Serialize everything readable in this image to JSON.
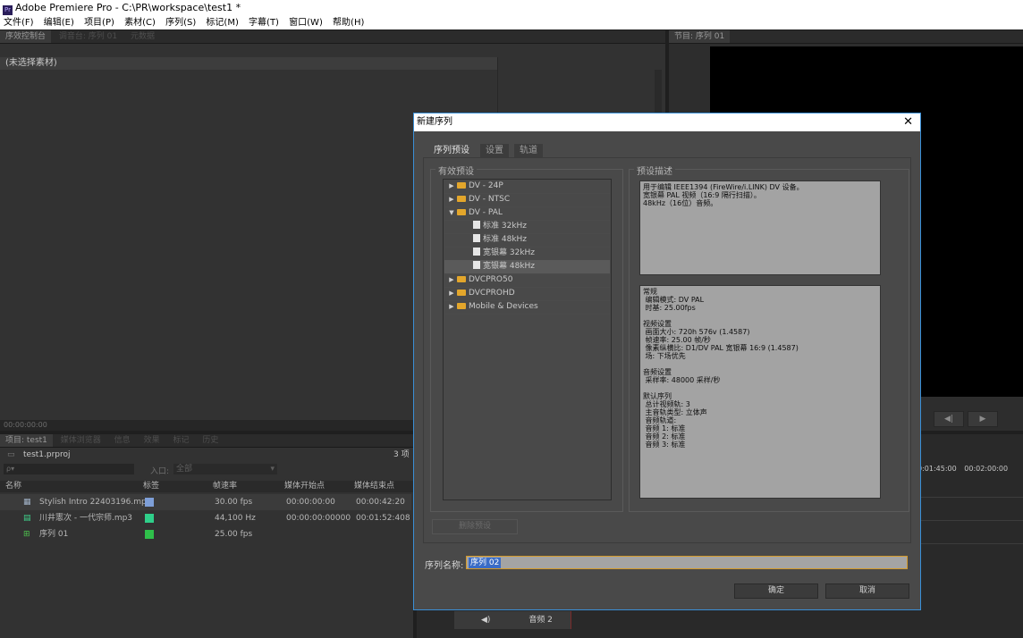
{
  "app": {
    "title": "Adobe Premiere Pro - C:\\PR\\workspace\\test1 *",
    "logo": "Pr"
  },
  "menu": [
    "文件(F)",
    "编辑(E)",
    "项目(P)",
    "素材(C)",
    "序列(S)",
    "标记(M)",
    "字幕(T)",
    "窗口(W)",
    "帮助(H)"
  ],
  "source_panel": {
    "tabs": [
      "序效控制台",
      "调音台: 序列 01",
      "元数据"
    ],
    "no_clip": "(未选择素材)",
    "timecode": "00:00:00:00"
  },
  "program_panel": {
    "tab": "节目: 序列 01",
    "timecodes": [
      "0:01:45:00",
      "00:02:00:00"
    ]
  },
  "project_panel": {
    "tabs": [
      "项目: test1",
      "媒体浏览器",
      "信息",
      "效果",
      "标记",
      "历史"
    ],
    "project_file": "test1.prproj",
    "item_count": "3 项",
    "search_placeholder": "ρ▾",
    "in_label": "入口:",
    "in_value": "全部",
    "columns": [
      "名称",
      "标签",
      "帧速率",
      "媒体开始点",
      "媒体结束点"
    ],
    "rows": [
      {
        "name": "Stylish Intro 22403196.mp4",
        "label_color": "#7e9fd8",
        "fps": "30.00 fps",
        "start": "00:00:00:00",
        "end": "00:00:42:20"
      },
      {
        "name": "川井憲次 - 一代宗师.mp3",
        "label_color": "#2fcf8a",
        "fps": "44,100 Hz",
        "start": "00:00:00:00000",
        "end": "00:01:52:408"
      },
      {
        "name": "序列 01",
        "label_color": "#2fbf4a",
        "fps": "25.00 fps",
        "start": "",
        "end": ""
      }
    ]
  },
  "timeline": {
    "track_label": "音频 2"
  },
  "dialog": {
    "title": "新建序列",
    "tabs": [
      "序列预设",
      "设置",
      "轨道"
    ],
    "presets_label": "有效预设",
    "desc_label": "预设描述",
    "tree": [
      {
        "label": "DV - 24P",
        "type": "folder",
        "level": 0,
        "expanded": false
      },
      {
        "label": "DV - NTSC",
        "type": "folder",
        "level": 0,
        "expanded": false
      },
      {
        "label": "DV - PAL",
        "type": "folder",
        "level": 0,
        "expanded": true
      },
      {
        "label": "标准 32kHz",
        "type": "preset",
        "level": 1
      },
      {
        "label": "标准 48kHz",
        "type": "preset",
        "level": 1
      },
      {
        "label": "宽银幕 32kHz",
        "type": "preset",
        "level": 1
      },
      {
        "label": "宽银幕 48kHz",
        "type": "preset",
        "level": 1,
        "selected": true
      },
      {
        "label": "DVCPRO50",
        "type": "folder",
        "level": 0,
        "expanded": false
      },
      {
        "label": "DVCPROHD",
        "type": "folder",
        "level": 0,
        "expanded": false
      },
      {
        "label": "Mobile & Devices",
        "type": "folder",
        "level": 0,
        "expanded": false
      }
    ],
    "description": [
      "用于编辑 IEEE1394 (FireWire/i.LINK) DV 设备。",
      "宽银幕 PAL 视频（16:9 隔行扫描）。",
      "48kHz（16位）音频。"
    ],
    "details": [
      "常规",
      " 编辑模式: DV PAL",
      " 时基: 25.00fps",
      "",
      "视频设置",
      " 画面大小: 720h 576v (1.4587)",
      " 帧速率: 25.00 帧/秒",
      " 像素纵横比: D1/DV PAL 宽银幕 16:9 (1.4587)",
      " 场: 下场优先",
      "",
      "音频设置",
      " 采样率: 48000 采样/秒",
      "",
      "默认序列",
      " 总计视频轨: 3",
      " 主音轨类型: 立体声",
      " 音频轨道:",
      " 音频 1: 标准",
      " 音频 2: 标准",
      " 音频 3: 标准"
    ],
    "delete_preset": "删除预设",
    "sequence_name_label": "序列名称:",
    "sequence_name_value": "序列 02",
    "ok": "确定",
    "cancel": "取消"
  }
}
